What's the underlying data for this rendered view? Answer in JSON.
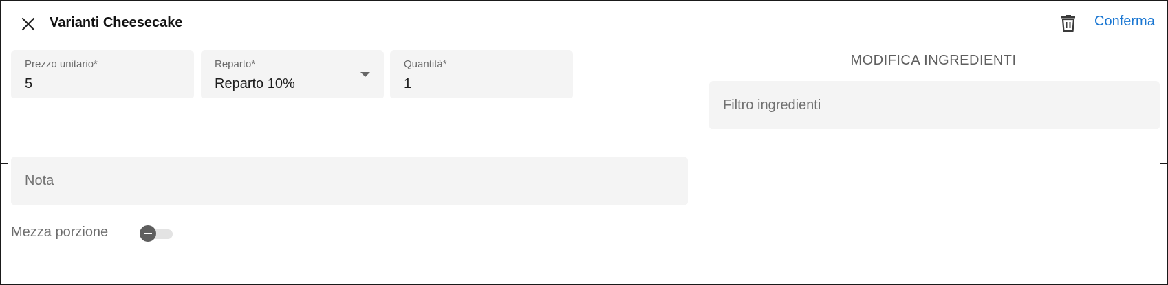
{
  "dialog": {
    "title": "Varianti Cheesecake",
    "confirm_label": "Conferma"
  },
  "fields": {
    "unit_price": {
      "label": "Prezzo unitario*",
      "value": "5"
    },
    "department": {
      "label": "Reparto*",
      "value": "Reparto 10%"
    },
    "quantity": {
      "label": "Quantità*",
      "value": "1"
    },
    "note": {
      "placeholder": "Nota"
    }
  },
  "ingredients": {
    "section_title": "MODIFICA INGREDIENTI",
    "filter_placeholder": "Filtro ingredienti"
  },
  "half_portion": {
    "label": "Mezza porzione",
    "checked": false
  },
  "icons": {
    "close": "close-icon",
    "delete": "trash-icon",
    "dropdown": "chevron-down-icon",
    "toggle_off": "minus-icon"
  },
  "colors": {
    "accent": "#1976d2",
    "field_background": "#f4f4f4"
  }
}
